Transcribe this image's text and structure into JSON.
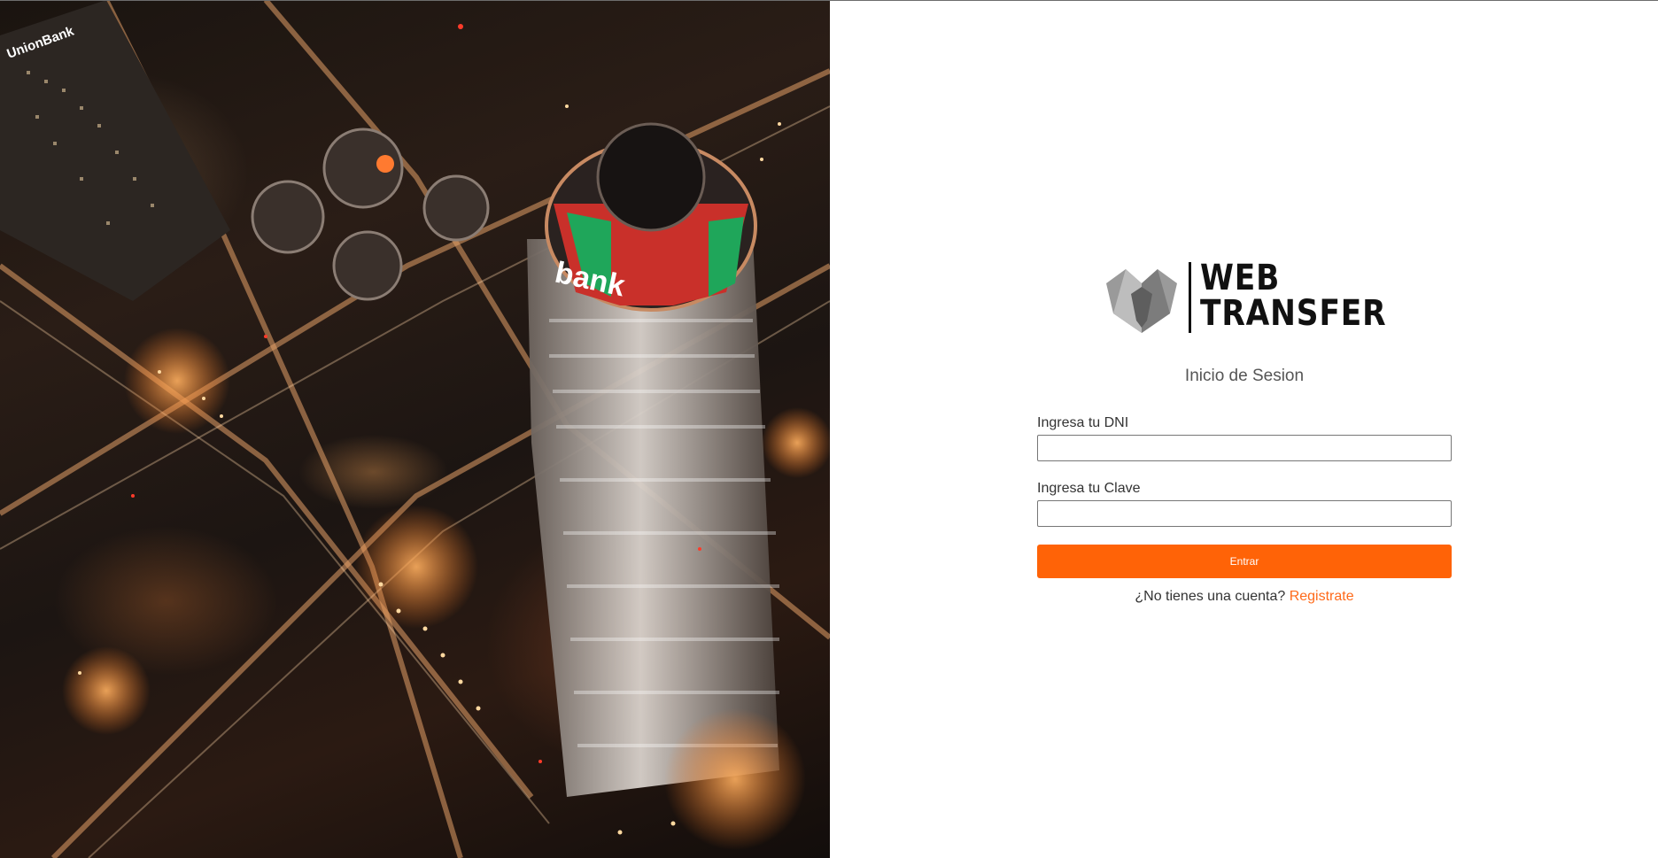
{
  "hero": {
    "image_description_icon": "city-night-aerial-photo",
    "sign_text_1": "UnionBank",
    "sign_text_2": "bank"
  },
  "logo": {
    "line1": "WEB",
    "line2": "TRANSFER"
  },
  "login": {
    "title": "Inicio de Sesion",
    "dni_label": "Ingresa tu DNI",
    "dni_value": "",
    "clave_label": "Ingresa tu Clave",
    "clave_value": "",
    "submit_label": "Entrar",
    "register_prompt": "¿No tienes una cuenta?",
    "register_link": "Registrate"
  },
  "colors": {
    "accent": "#ff6307",
    "link": "#ff6a1a",
    "text": "#333333"
  }
}
